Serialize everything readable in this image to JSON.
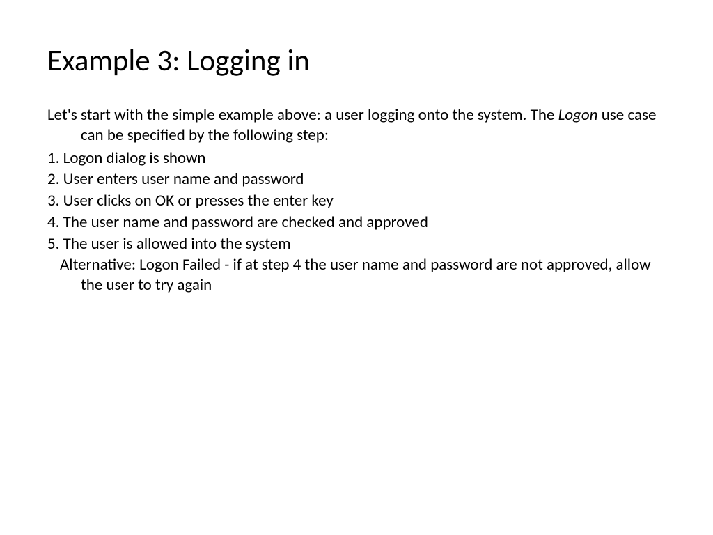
{
  "title": "Example 3: Logging in",
  "intro_part1": "Let's start with the simple example above: a user logging onto the system.  The ",
  "intro_italic": "Logon",
  "intro_part2": " use case can be specified by the following step:",
  "steps": [
    "1. Logon dialog is shown",
    "2. User enters user name and password",
    "3. User clicks on OK or presses the enter key",
    "4. The user name and password are checked and approved",
    "5. The user is allowed into the system"
  ],
  "alternative": "Alternative: Logon Failed - if at step 4 the user name and password are not approved, allow the user to try again"
}
